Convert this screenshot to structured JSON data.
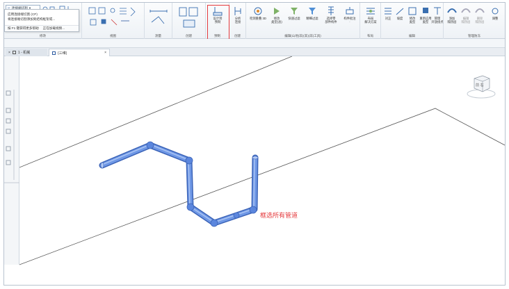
{
  "selector": {
    "value": "连接端切割"
  },
  "tooltip": {
    "line1": "应用连接端切割 (CP)",
    "line2": "将连接端切割添加到结构框架或...",
    "hint1": "按 F1 键获得更多帮助",
    "hint2": "正在加载视频..."
  },
  "ribbon": {
    "groups": [
      {
        "label": "修改"
      },
      {
        "label": "视图"
      },
      {
        "label": "测量"
      },
      {
        "label": "创建"
      },
      {
        "label": "预制"
      },
      {
        "label": "创建"
      },
      {
        "label": "编辑(山地(非)(非)(非)工具)"
      },
      {
        "label": "布局"
      },
      {
        "label": "编辑"
      },
      {
        "label": "管理防冻"
      }
    ],
    "tools": {
      "design_to_fab": "设计到\n预制",
      "analysis": "分析\n连接",
      "clash": "检测重叠 3D",
      "change_type": "修改\n类型(总)",
      "quick_filter": "快速过滤",
      "advanced_filter": "精细过滤",
      "select_part": "选择零\n部件构件",
      "tag": "构件批注\n·",
      "layout_solution": "布局\n解决方案",
      "align": "对正",
      "slope": "坡度",
      "modify_type": "修改\n类型",
      "reapply": "重新应用\n类型",
      "manage_open": "管理\n开放接点",
      "add_insulation": "添加\n隔热层",
      "edit_insulation": "编辑\n隔热层",
      "remove_insulation": "删除\n隔热层",
      "adjust": "调整"
    }
  },
  "tabs": [
    {
      "label": "1 - 机械",
      "icon": "floor-plan-icon"
    },
    {
      "label": "{三维}",
      "icon": "3d-view-icon"
    }
  ],
  "navcube": {
    "face": "前 右"
  },
  "annotation": {
    "text": "框选所有管道"
  },
  "colors": {
    "pipe": "#5b86dd",
    "highlight": "#e4393c"
  }
}
